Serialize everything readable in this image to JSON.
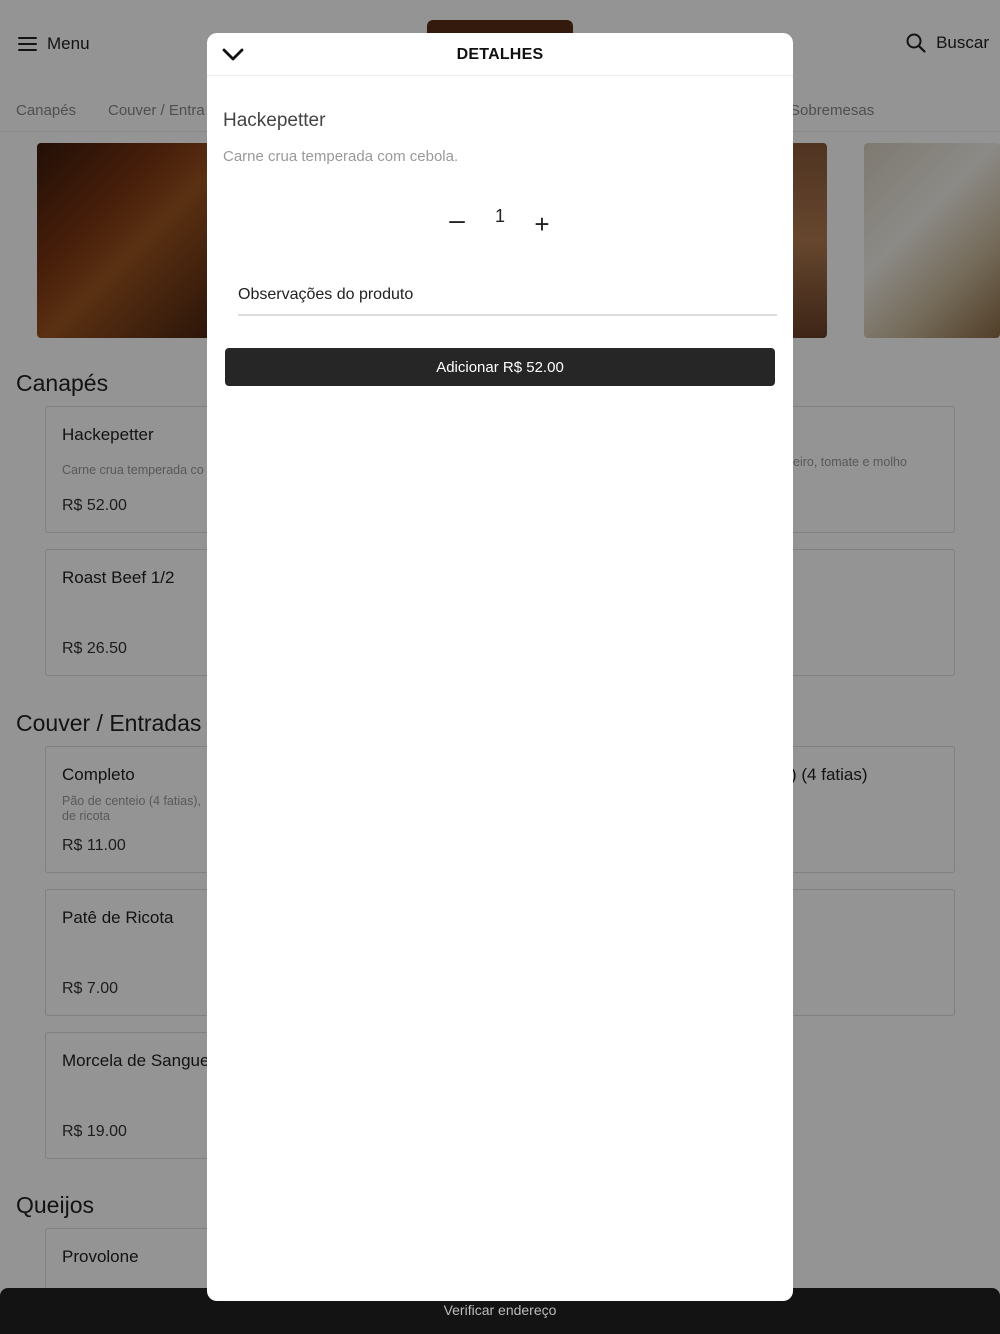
{
  "header": {
    "menu_label": "Menu",
    "search_label": "Buscar",
    "icons": {
      "menu": "hamburger-icon",
      "search": "search-icon",
      "close": "chevron-down-icon"
    }
  },
  "category_tabs": [
    "Canapés",
    "Couver / Entra",
    "Sobremesas"
  ],
  "sections": {
    "canapes": {
      "title": "Canapés",
      "items": [
        {
          "name": "Hackepetter",
          "desc": "Carne crua temperada co",
          "price": "R$ 52.00"
        },
        {
          "name": "Roast Beef 1/2",
          "desc": "",
          "price": "R$ 26.50"
        }
      ],
      "right_items": [
        {
          "name": "",
          "desc": "eiro, tomate e molho"
        },
        {
          "name": "",
          "desc": ""
        }
      ]
    },
    "couver": {
      "title": "Couver / Entradas",
      "items": [
        {
          "name": "Completo",
          "desc": "Pão de centeio (4 fatias),",
          "desc2": "de ricota",
          "price": "R$ 11.00"
        },
        {
          "name": "Patê de Ricota",
          "desc": "",
          "price": "R$ 7.00"
        },
        {
          "name": "Morcela de Sangue",
          "desc": "",
          "price": "R$ 19.00"
        }
      ],
      "right_items": [
        {
          "name": ") (4 fatias)",
          "desc": ""
        },
        {
          "name": "",
          "desc": ""
        }
      ]
    },
    "queijos": {
      "title": "Queijos",
      "items": [
        {
          "name": "Provolone",
          "desc": "",
          "price": ""
        }
      ]
    }
  },
  "footer": {
    "label": "Verificar endereço"
  },
  "modal": {
    "title": "DETALHES",
    "product_name": "Hackepetter",
    "product_desc": "Carne crua temperada com cebola.",
    "quantity": "1",
    "minus_symbol": "–",
    "plus_symbol": "+",
    "notes_placeholder": "Observações do produto",
    "add_button_label": "Adicionar R$ 52.00"
  }
}
